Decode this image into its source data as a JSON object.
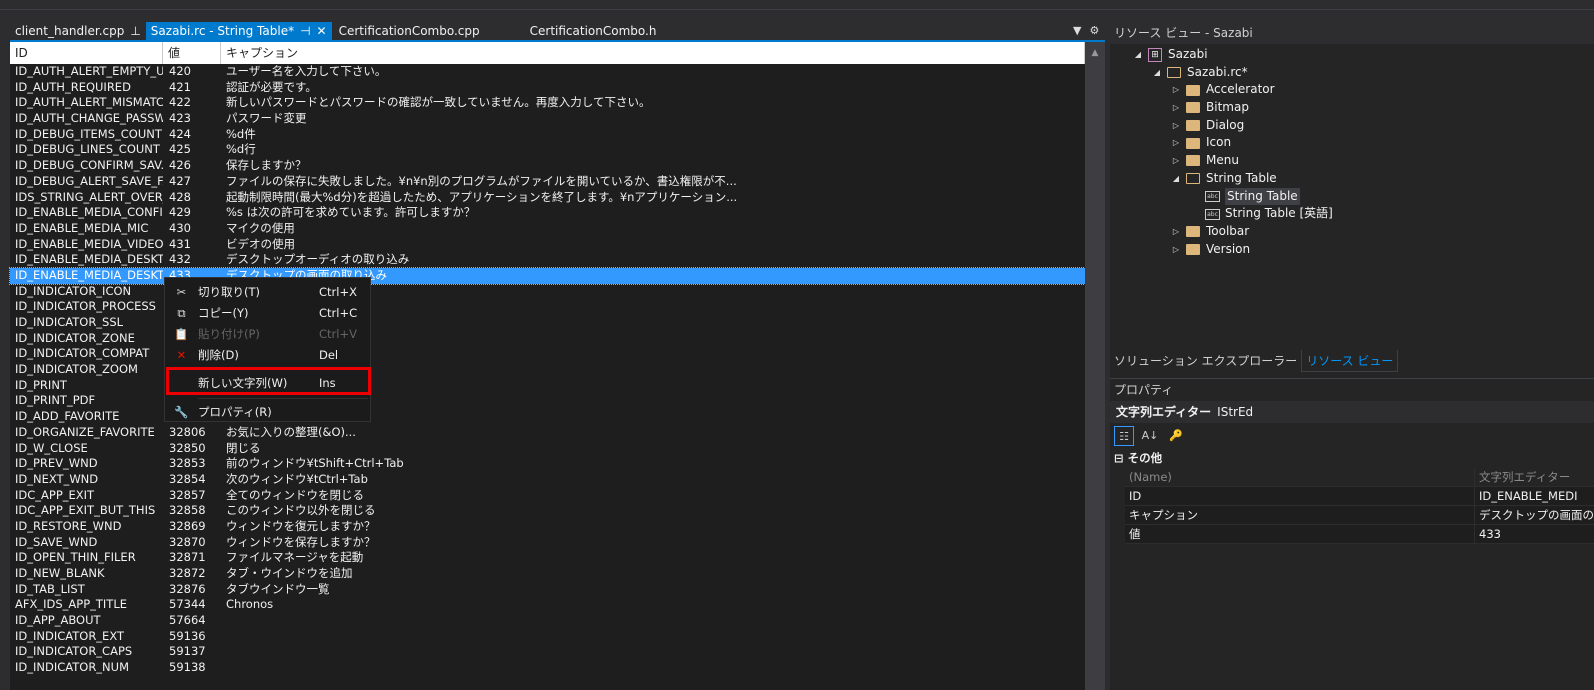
{
  "tabs": [
    {
      "label": "client_handler.cpp",
      "icon": "pin-icon",
      "active": false
    },
    {
      "label": "Sazabi.rc - String Table*",
      "icon": "pin-icon",
      "active": true
    },
    {
      "label": "CertificationCombo.cpp",
      "active": false
    },
    {
      "label": "CertificationCombo.h",
      "active": false
    }
  ],
  "table": {
    "headers": [
      "ID",
      "値",
      "キャプション"
    ],
    "rows": [
      [
        "ID_AUTH_ALERT_EMPTY_U...",
        "420",
        "ユーザー名を入力して下さい。"
      ],
      [
        "ID_AUTH_REQUIRED",
        "421",
        "認証が必要です。"
      ],
      [
        "ID_AUTH_ALERT_MISMATC...",
        "422",
        "新しいパスワードとパスワードの確認が一致していません。再度入力して下さい。"
      ],
      [
        "ID_AUTH_CHANGE_PASSW...",
        "423",
        "パスワード変更"
      ],
      [
        "ID_DEBUG_ITEMS_COUNT",
        "424",
        "%d件"
      ],
      [
        "ID_DEBUG_LINES_COUNT",
        "425",
        "%d行"
      ],
      [
        "ID_DEBUG_CONFIRM_SAV...",
        "426",
        "保存しますか？"
      ],
      [
        "ID_DEBUG_ALERT_SAVE_FA...",
        "427",
        "ファイルの保存に失敗しました。¥n¥n別のプログラムがファイルを開いているか、書込権限が不..."
      ],
      [
        "IDS_STRING_ALERT_OVER_...",
        "428",
        "起動制限時間(最大%d分)を超過したため、アプリケーションを終了します。¥nアプリケーション..."
      ],
      [
        "ID_ENABLE_MEDIA_CONFI...",
        "429",
        "%s は次の許可を求めています。許可しますか？"
      ],
      [
        "ID_ENABLE_MEDIA_MIC",
        "430",
        "マイクの使用"
      ],
      [
        "ID_ENABLE_MEDIA_VIDEO",
        "431",
        "ビデオの使用"
      ],
      [
        "ID_ENABLE_MEDIA_DESKT...",
        "432",
        "デスクトップオーディオの取り込み"
      ],
      [
        "ID_ENABLE_MEDIA_DESKT...",
        "433",
        "デスクトップの画面の取り込み"
      ],
      [
        "ID_INDICATOR_ICON",
        "",
        ""
      ],
      [
        "ID_INDICATOR_PROCESS",
        "",
        ""
      ],
      [
        "ID_INDICATOR_SSL",
        "",
        ""
      ],
      [
        "ID_INDICATOR_ZONE",
        "",
        ""
      ],
      [
        "ID_INDICATOR_COMPAT",
        "",
        ""
      ],
      [
        "ID_INDICATOR_ZOOM",
        "",
        ""
      ],
      [
        "ID_PRINT",
        "",
        ""
      ],
      [
        "ID_PRINT_PDF",
        "",
        ""
      ],
      [
        "ID_ADD_FAVORITE",
        "",
        ""
      ],
      [
        "ID_ORGANIZE_FAVORITE",
        "32806",
        "お気に入りの整理(&O)..."
      ],
      [
        "ID_W_CLOSE",
        "32850",
        "閉じる"
      ],
      [
        "ID_PREV_WND",
        "32853",
        "前のウィンドウ¥tShift+Ctrl+Tab"
      ],
      [
        "ID_NEXT_WND",
        "32854",
        "次のウィンドウ¥tCtrl+Tab"
      ],
      [
        "IDC_APP_EXIT",
        "32857",
        "全てのウィンドウを閉じる"
      ],
      [
        "IDC_APP_EXIT_BUT_THIS",
        "32858",
        "このウィンドウ以外を閉じる"
      ],
      [
        "ID_RESTORE_WND",
        "32869",
        "ウィンドウを復元しますか？"
      ],
      [
        "ID_SAVE_WND",
        "32870",
        "ウィンドウを保存しますか？"
      ],
      [
        "ID_OPEN_THIN_FILER",
        "32871",
        "ファイルマネージャを起動"
      ],
      [
        "ID_NEW_BLANK",
        "32872",
        "タブ・ウインドウを追加"
      ],
      [
        "ID_TAB_LIST",
        "32876",
        "タブウインドウ一覧"
      ],
      [
        "AFX_IDS_APP_TITLE",
        "57344",
        "Chronos"
      ],
      [
        "ID_APP_ABOUT",
        "57664",
        ""
      ],
      [
        "ID_INDICATOR_EXT",
        "59136",
        ""
      ],
      [
        "ID_INDICATOR_CAPS",
        "59137",
        ""
      ],
      [
        "ID_INDICATOR_NUM",
        "59138",
        ""
      ]
    ],
    "selected_index": 13
  },
  "context_menu": {
    "items": [
      {
        "label": "切り取り(T)",
        "shortcut": "Ctrl+X",
        "icon": "scissors-icon",
        "enabled": true
      },
      {
        "label": "コピー(Y)",
        "shortcut": "Ctrl+C",
        "icon": "copy-icon",
        "enabled": true
      },
      {
        "label": "貼り付け(P)",
        "shortcut": "Ctrl+V",
        "icon": "paste-icon",
        "enabled": false
      },
      {
        "label": "削除(D)",
        "shortcut": "Del",
        "icon": "delete-icon",
        "enabled": true
      },
      {
        "label": "新しい文字列(W)",
        "shortcut": "Ins",
        "highlighted_box": true,
        "enabled": true
      },
      {
        "label": "プロパティ(R)",
        "shortcut": "",
        "icon": "wrench-icon",
        "enabled": true
      }
    ],
    "highlight_color": "#ee0000"
  },
  "resource_view": {
    "title": "リソース ビュー - Sazabi",
    "tree": [
      {
        "label": "Sazabi",
        "level": 0,
        "type": "project",
        "expanded": true
      },
      {
        "label": "Sazabi.rc*",
        "level": 1,
        "type": "folder-open",
        "expanded": true
      },
      {
        "label": "Accelerator",
        "level": 2,
        "type": "folder"
      },
      {
        "label": "Bitmap",
        "level": 2,
        "type": "folder"
      },
      {
        "label": "Dialog",
        "level": 2,
        "type": "folder"
      },
      {
        "label": "Icon",
        "level": 2,
        "type": "folder"
      },
      {
        "label": "Menu",
        "level": 2,
        "type": "folder"
      },
      {
        "label": "String Table",
        "level": 2,
        "type": "folder-open",
        "expanded": true
      },
      {
        "label": "String Table",
        "level": 3,
        "type": "string-table",
        "selected": true
      },
      {
        "label": "String Table [英語]",
        "level": 3,
        "type": "string-table"
      },
      {
        "label": "Toolbar",
        "level": 2,
        "type": "folder"
      },
      {
        "label": "Version",
        "level": 2,
        "type": "folder"
      }
    ]
  },
  "bottom_tabs": [
    {
      "label": "ソリューション エクスプローラー",
      "active": false
    },
    {
      "label": "リソース ビュー",
      "active": true
    }
  ],
  "properties": {
    "title": "プロパティ",
    "object_name": "文字列エディター",
    "object_type": "IStrEd",
    "category": "その他",
    "rows": [
      {
        "name": "(Name)",
        "value": "文字列エディター"
      },
      {
        "name": "ID",
        "value": "ID_ENABLE_MEDI"
      },
      {
        "name": "キャプション",
        "value": "デスクトップの画面の"
      },
      {
        "name": "値",
        "value": "433"
      }
    ]
  },
  "colors": {
    "accent": "#007acc",
    "selection": "#3399ff",
    "folder": "#dcb67a"
  }
}
